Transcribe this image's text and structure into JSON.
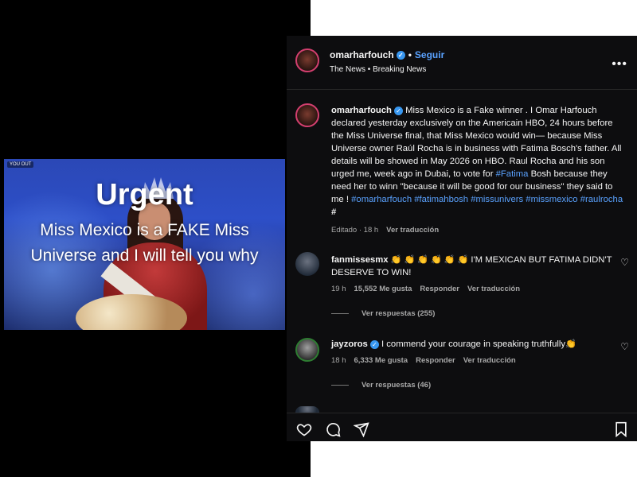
{
  "video": {
    "tag": "YOU OUT",
    "title": "Urgent",
    "line1": "Miss Mexico is a FAKE Miss",
    "line2": "Universe and I will tell you why"
  },
  "header": {
    "username": "omarharfouch",
    "verified_mark": "✓",
    "follow_label": "Seguir",
    "subtitle": "The News • Breaking News",
    "more_icon": "more-horizontal-icon"
  },
  "caption": {
    "username": "omarharfouch",
    "text": "Miss Mexico is a Fake winner . I Omar Harfouch declared yesterday exclusively on the Americain HBO, 24 hours before the Miss Universe final, that Miss Mexico would win— because Miss Universe owner Raúl Rocha is in business with Fatima Bosch's father. All details will be showed in May 2026 on HBO. Raul Rocha and his son urged me, week ago in Dubai, to vote for",
    "tag1": "#Fatima",
    "text2": "Bosh because they need her to winn \"because it will be good for our business\" they said to me !",
    "tag2": "#omarharfouch",
    "tag3": "#fatimahbosh",
    "tag4": "#missunivers",
    "tag5": "#missmexico",
    "tag6": "#raulrocha",
    "tag7": "#",
    "edited": "Editado · 18 h",
    "translate": "Ver traducción"
  },
  "comments": [
    {
      "username": "fanmissesmx",
      "claps": "👏 👏 👏 👏 👏 👏",
      "text": "I'M MEXICAN BUT FATIMA DIDN'T DESERVE TO WIN!",
      "time": "19 h",
      "likes": "15,552 Me gusta",
      "reply": "Responder",
      "translate": "Ver traducción",
      "view_replies": "Ver respuestas (255)"
    },
    {
      "username": "jayzoros",
      "text": "I commend your courage in speaking truthfully",
      "clap": "👏",
      "time": "18 h",
      "likes": "6,333 Me gusta",
      "reply": "Responder",
      "translate": "Ver traducción",
      "view_replies": "Ver respuestas (46)"
    }
  ],
  "actions": [
    "heart-icon",
    "comment-icon",
    "share-icon",
    "save-icon"
  ],
  "colors": {
    "accent": "#5aa2ff",
    "panel_bg": "#0d0d0f",
    "verified": "#3897f0"
  }
}
